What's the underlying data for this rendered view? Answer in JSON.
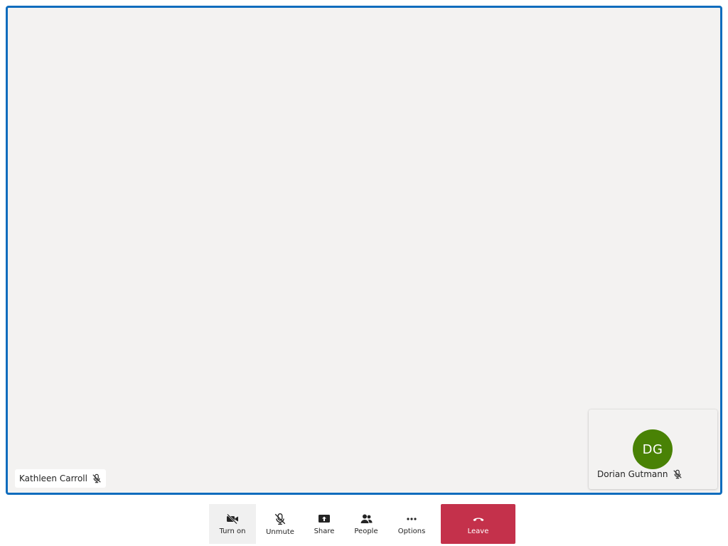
{
  "colors": {
    "accent": "#0f6cbd",
    "avatar_bg": "#498205",
    "leave_bg": "#c4314b"
  },
  "main_participant": {
    "name": "Kathleen Carroll",
    "status_icon": "mic-off-icon"
  },
  "self_view": {
    "initials": "DG",
    "name": "Dorian Gutmann",
    "status_icon": "mic-off-icon"
  },
  "toolbar": {
    "camera": {
      "label": "Turn on",
      "icon": "camera-off-icon"
    },
    "mic": {
      "label": "Unmute",
      "icon": "mic-off-icon"
    },
    "share": {
      "label": "Share",
      "icon": "share-screen-icon"
    },
    "people": {
      "label": "People",
      "icon": "people-icon"
    },
    "options": {
      "label": "Options",
      "icon": "more-icon"
    },
    "leave": {
      "label": "Leave",
      "icon": "hang-up-icon"
    }
  }
}
